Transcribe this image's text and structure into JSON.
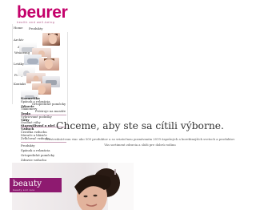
{
  "brand": {
    "name": "beurer",
    "tagline": "health and well-being"
  },
  "top_nav": {
    "home": "Home",
    "products": "Produkty"
  },
  "sidebar": {
    "items": [
      {
        "label": "Archív"
      },
      {
        "label": "Aplikácie"
      },
      {
        "label": "Wellbeing"
      },
      {
        "label": "Letáky"
      },
      {
        "label": "Fotky"
      },
      {
        "label": "Kontakt"
      }
    ]
  },
  "stacked_menu": [
    {
      "label": "Kozmetika",
      "bold": true
    },
    {
      "label": "Spánok a relaxácia",
      "bold": true
    },
    {
      "label": "Ortopedické pomôcky",
      "bold": false
    },
    {
      "label": "Zdravie",
      "bold": true
    },
    {
      "label": "Tlakomery",
      "bold": false
    },
    {
      "label": "Prístroje na masáže",
      "bold": false
    },
    {
      "label": "Teplo",
      "bold": true
    },
    {
      "label": "Vyhrievané podušky",
      "bold": false
    },
    {
      "label": "Váhy",
      "bold": true
    },
    {
      "label": "Osobné váhy",
      "bold": false
    },
    {
      "label": "Starostlivosť o pleť",
      "bold": true
    },
    {
      "label": "Vzduch",
      "bold": true
    },
    {
      "label": "Čistička vzduchu",
      "bold": false
    },
    {
      "label": "Merače a hlásiče",
      "bold": false
    },
    {
      "label": "Zvlhčovač vzduchu",
      "bold": false
    }
  ],
  "lower_menu": [
    {
      "label": "Produkty",
      "bold": false
    },
    {
      "label": "Spánok a relaxácia",
      "bold": false
    },
    {
      "label": "Ortopedické pomôcky",
      "bold": false
    },
    {
      "label": "Zdravie vzduchu",
      "bold": false
    },
    {
      "label": "Infradaune",
      "bold": true
    },
    {
      "label": "PhysioLine",
      "bold": true
    },
    {
      "label": "Masáže a masážne",
      "bold": false
    },
    {
      "label": "Aplikácie",
      "bold": false
    },
    {
      "label": "Masáž tela",
      "bold": true
    },
    {
      "label": "Relaxácia",
      "bold": true
    }
  ],
  "main": {
    "headline": "Chceme, aby ste sa cítili výborne.",
    "body_line1": "Prostredníctvom viac ako 500 produktov a so sviatočnou poznávaním 2019 úspešných a korektnejších svetoch a produktov",
    "body_line2": "Vás sortiment zdravia a slúži pre dobrú rodinu",
    "banner": {
      "title": "beauty",
      "subtitle": "beauty and care"
    }
  },
  "colors": {
    "brand": "#c4006a",
    "banner": "#8e1a70",
    "rule": "#c8a0b8"
  }
}
